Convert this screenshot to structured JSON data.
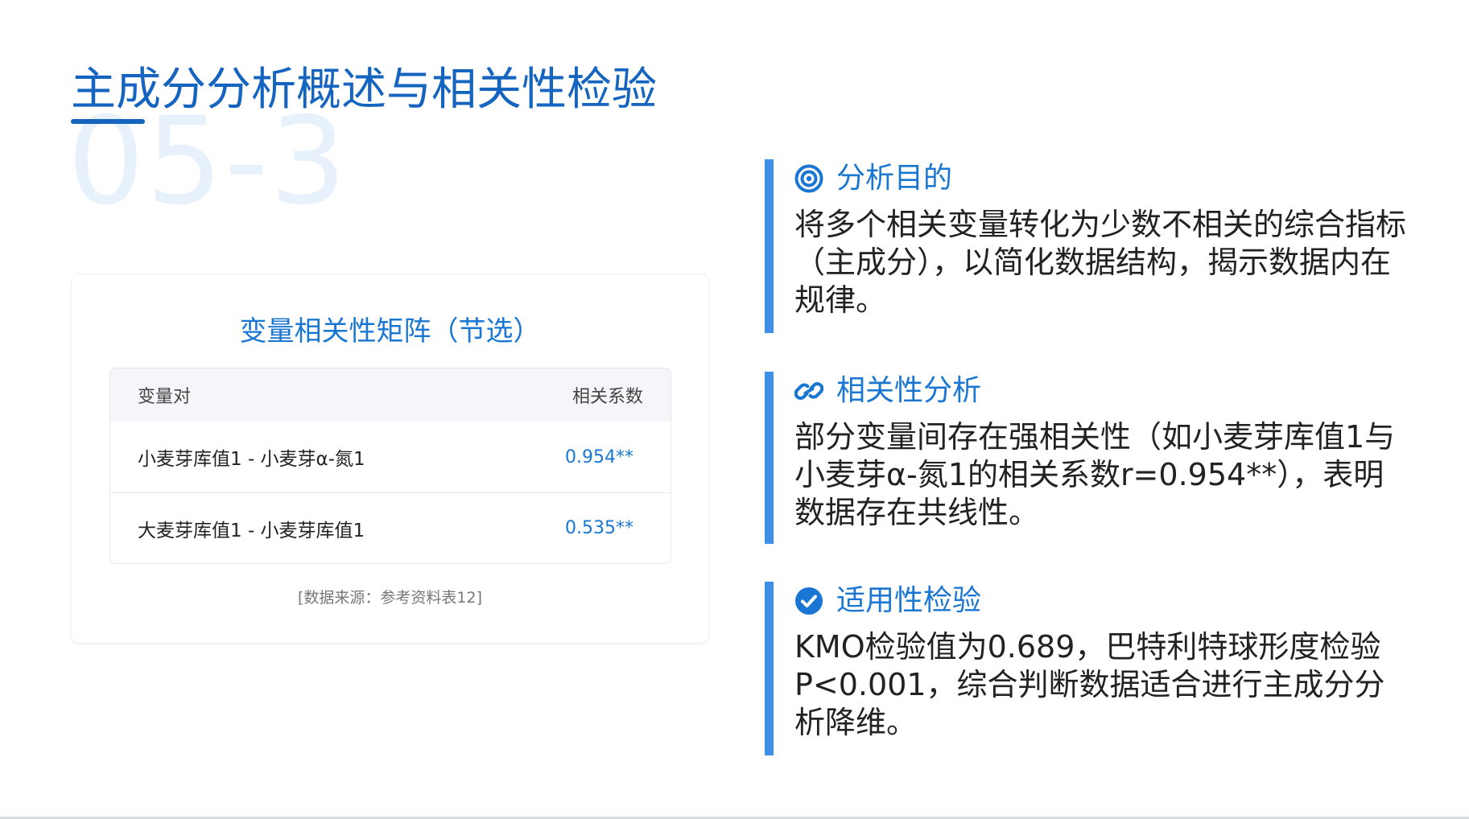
{
  "page_title": "主成分分析概述与相关性检验",
  "section_number": "05-3",
  "card": {
    "title": "变量相关性矩阵（节选）",
    "columns": [
      "变量对",
      "相关系数"
    ],
    "rows": [
      {
        "pair": "小麦芽库值1 - 小麦芽α-氮1",
        "value": "0.954**"
      },
      {
        "pair": "大麦芽库值1 - 小麦芽库值1",
        "value": "0.535**"
      }
    ],
    "source": "[数据来源：参考资料表12]"
  },
  "sections": [
    {
      "icon": "target-icon",
      "title": "分析目的",
      "body": "将多个相关变量转化为少数不相关的综合指标（主成分），以简化数据结构，揭示数据内在规律。"
    },
    {
      "icon": "link-icon",
      "title": "相关性分析",
      "body": "部分变量间存在强相关性（如小麦芽库值1与小麦芽α-氮1的相关系数r=0.954**），表明数据存在共线性。"
    },
    {
      "icon": "check-circle-icon",
      "title": "适用性检验",
      "body": "KMO检验值为0.689，巴特利特球形度检验P<0.001，综合判断数据适合进行主成分分析降维。"
    }
  ],
  "colors": {
    "accent": "#1976d2",
    "title": "#1565c0",
    "section_bar": "#3d8fe8",
    "watermark": "#e6f1fc"
  }
}
